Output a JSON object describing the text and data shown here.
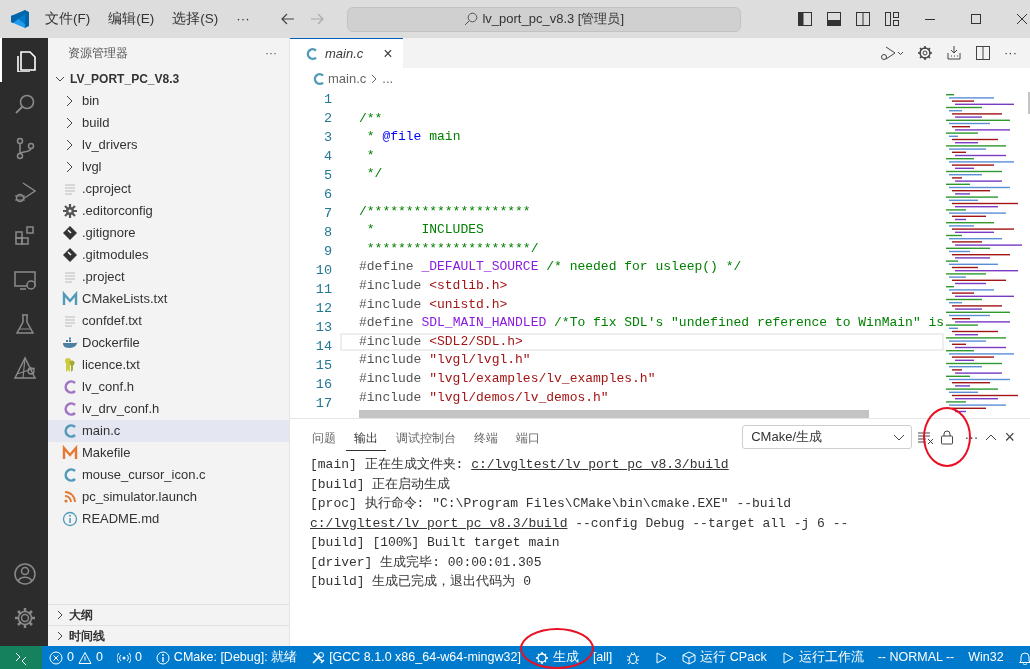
{
  "title_bar": {
    "menus": [
      "文件(F)",
      "编辑(E)",
      "选择(S)"
    ],
    "more": "···",
    "search": "lv_port_pc_v8.3 [管理员]"
  },
  "activity_bar": {
    "top": [
      {
        "kind": "files",
        "selected": true
      },
      {
        "kind": "search",
        "selected": false
      },
      {
        "kind": "source-control",
        "selected": false
      },
      {
        "kind": "run-debug",
        "selected": false
      },
      {
        "kind": "extensions",
        "selected": false
      },
      {
        "kind": "remote",
        "selected": false
      },
      {
        "kind": "testing",
        "selected": false
      },
      {
        "kind": "cmake",
        "selected": false
      }
    ],
    "bottom": [
      {
        "kind": "account",
        "selected": false
      },
      {
        "kind": "settings",
        "selected": false
      }
    ]
  },
  "explorer": {
    "title": "资源管理器",
    "more": "···",
    "root": {
      "label": "LV_PORT_PC_V8.3",
      "expanded": true
    },
    "items": [
      {
        "label": "bin",
        "kind": "folder",
        "selected": false
      },
      {
        "label": "build",
        "kind": "folder",
        "selected": false
      },
      {
        "label": "lv_drivers",
        "kind": "folder",
        "selected": false
      },
      {
        "label": "lvgl",
        "kind": "folder",
        "selected": false
      },
      {
        "label": ".cproject",
        "kind": "text",
        "selected": false
      },
      {
        "label": ".editorconfig",
        "kind": "gear",
        "selected": false
      },
      {
        "label": ".gitignore",
        "kind": "git",
        "selected": false
      },
      {
        "label": ".gitmodules",
        "kind": "git",
        "selected": false
      },
      {
        "label": ".project",
        "kind": "text",
        "selected": false
      },
      {
        "label": "CMakeLists.txt",
        "kind": "cmake",
        "selected": false
      },
      {
        "label": "confdef.txt",
        "kind": "text",
        "selected": false
      },
      {
        "label": "Dockerfile",
        "kind": "docker",
        "selected": false
      },
      {
        "label": "licence.txt",
        "kind": "license",
        "selected": false
      },
      {
        "label": "lv_conf.h",
        "kind": "header",
        "selected": false
      },
      {
        "label": "lv_drv_conf.h",
        "kind": "header",
        "selected": false
      },
      {
        "label": "main.c",
        "kind": "c",
        "selected": true
      },
      {
        "label": "Makefile",
        "kind": "makefile",
        "selected": false
      },
      {
        "label": "mouse_cursor_icon.c",
        "kind": "c",
        "selected": false
      },
      {
        "label": "pc_simulator.launch",
        "kind": "rss",
        "selected": false
      },
      {
        "label": "README.md",
        "kind": "info",
        "selected": false
      }
    ],
    "sections": [
      {
        "label": "大纲",
        "expanded": false
      },
      {
        "label": "时间线",
        "expanded": false
      }
    ]
  },
  "editor": {
    "more": "···",
    "tabs": [
      {
        "label": "main.c",
        "selected": true,
        "close": "×"
      }
    ],
    "breadcrumb": [
      "main.c",
      "..."
    ],
    "lines": [
      {
        "number": "1",
        "current": false
      },
      {
        "number": "2",
        "current": false,
        "segments": [
          {
            "text": "/**",
            "kind": "comment"
          }
        ]
      },
      {
        "number": "3",
        "current": false,
        "segments": [
          {
            "text": " * ",
            "kind": "comment"
          },
          {
            "text": "@file",
            "kind": "doc-tag"
          },
          {
            "text": " main",
            "kind": "comment"
          }
        ]
      },
      {
        "number": "4",
        "current": false,
        "segments": [
          {
            "text": " *",
            "kind": "comment"
          }
        ]
      },
      {
        "number": "5",
        "current": false,
        "segments": [
          {
            "text": " */",
            "kind": "comment"
          }
        ]
      },
      {
        "number": "6",
        "current": false
      },
      {
        "number": "7",
        "current": false,
        "segments": [
          {
            "text": "/*********************",
            "kind": "comment"
          }
        ]
      },
      {
        "number": "8",
        "current": false,
        "segments": [
          {
            "text": " *      INCLUDES",
            "kind": "comment"
          }
        ]
      },
      {
        "number": "9",
        "current": false,
        "segments": [
          {
            "text": " *********************/",
            "kind": "comment"
          }
        ]
      },
      {
        "number": "10",
        "current": false,
        "segments": [
          {
            "text": "#define ",
            "kind": "directive"
          },
          {
            "text": "_DEFAULT_SOURCE",
            "kind": "macro"
          },
          {
            "text": " /* needed for usleep() */",
            "kind": "comment"
          }
        ]
      },
      {
        "number": "11",
        "current": false,
        "segments": [
          {
            "text": "#include ",
            "kind": "directive"
          },
          {
            "text": "<stdlib.h>",
            "kind": "string"
          }
        ]
      },
      {
        "number": "12",
        "current": false,
        "segments": [
          {
            "text": "#include ",
            "kind": "directive"
          },
          {
            "text": "<unistd.h>",
            "kind": "string"
          }
        ]
      },
      {
        "number": "13",
        "current": false,
        "segments": [
          {
            "text": "#define ",
            "kind": "directive"
          },
          {
            "text": "SDL_MAIN_HANDLED",
            "kind": "macro"
          },
          {
            "text": " /*To fix SDL's \"undefined reference to WinMain\" is",
            "kind": "comment"
          }
        ]
      },
      {
        "number": "14",
        "current": true,
        "segments": [
          {
            "text": "#include ",
            "kind": "directive"
          },
          {
            "text": "<SDL2/SDL.h>",
            "kind": "string"
          }
        ]
      },
      {
        "number": "15",
        "current": false,
        "segments": [
          {
            "text": "#include ",
            "kind": "directive"
          },
          {
            "text": "\"lvgl/lvgl.h\"",
            "kind": "string"
          }
        ]
      },
      {
        "number": "16",
        "current": false,
        "segments": [
          {
            "text": "#include ",
            "kind": "directive"
          },
          {
            "text": "\"lvgl/examples/lv_examples.h\"",
            "kind": "string"
          }
        ]
      },
      {
        "number": "17",
        "current": false,
        "segments": [
          {
            "text": "#include ",
            "kind": "directive"
          },
          {
            "text": "\"lvgl/demos/lv_demos.h\"",
            "kind": "string"
          }
        ]
      }
    ]
  },
  "panel": {
    "tabs": [
      {
        "label": "问题",
        "selected": false
      },
      {
        "label": "输出",
        "selected": true
      },
      {
        "label": "调试控制台",
        "selected": false
      },
      {
        "label": "终端",
        "selected": false
      },
      {
        "label": "端口",
        "selected": false
      }
    ],
    "channel": "CMake/生成",
    "lock": {
      "circled": true
    },
    "more": "···",
    "close": "×",
    "lines": [
      [
        {
          "text": "[main] 正在生成文件夹: ",
          "kind": "plain"
        },
        {
          "text": "c:/lvgltest/lv_port_pc_v8.3/build",
          "kind": "link"
        }
      ],
      [
        {
          "text": "[build] 正在启动生成",
          "kind": "plain"
        }
      ],
      [
        {
          "text": "[proc] 执行命令: \"C:\\Program Files\\CMake\\bin\\cmake.EXE\" --build ",
          "kind": "plain"
        },
        {
          "text": "c:/lvgltest/lv_port_pc_v8.3/build",
          "kind": "link"
        },
        {
          "text": " --config Debug --target all -j 6 --",
          "kind": "plain"
        }
      ],
      [
        {
          "text": "[build] [100%] Built target main",
          "kind": "plain"
        }
      ],
      [
        {
          "text": "[driver] 生成完毕: 00:00:01.305",
          "kind": "plain"
        }
      ],
      [
        {
          "text": "[build] 生成已完成，退出代码为 0",
          "kind": "plain"
        }
      ]
    ]
  },
  "status_bar": {
    "left": [
      {
        "kind": "remote"
      },
      {
        "kind": "problems",
        "errors": "0",
        "warnings": "0"
      },
      {
        "kind": "ports",
        "text": "0"
      },
      {
        "kind": "info",
        "text": "CMake: [Debug]: 就绪"
      },
      {
        "kind": "tools",
        "text": "[GCC 8.1.0 x86_64-w64-mingw32]"
      },
      {
        "kind": "gear",
        "text": "生成",
        "circled": true
      },
      {
        "kind": "plain",
        "text": "[all]"
      },
      {
        "kind": "debug"
      },
      {
        "kind": "run"
      },
      {
        "kind": "package",
        "text": "运行 CPack"
      },
      {
        "kind": "run",
        "text": "运行工作流"
      },
      {
        "kind": "plain",
        "text": "-- NORMAL --"
      }
    ],
    "right": [
      {
        "kind": "plain",
        "text": "Win32"
      },
      {
        "kind": "bell"
      }
    ]
  }
}
